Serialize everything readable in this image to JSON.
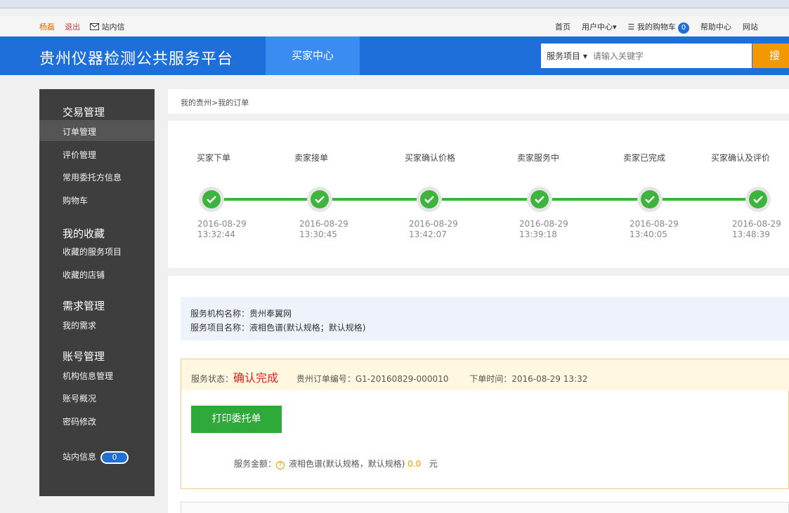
{
  "topbar": {
    "user": "杨磊",
    "logout": "退出",
    "mail": "站内信",
    "home": "首页",
    "user_center": "用户中心",
    "cart": "我的购物车",
    "cart_count": "0",
    "help": "帮助中心",
    "site": "网站"
  },
  "header": {
    "logo": "贵州仪器检测公共服务平台",
    "tab": "买家中心",
    "search_category": "服务项目",
    "search_placeholder": "请输入关键字",
    "search_button": "搜索"
  },
  "sidebar": {
    "groups": [
      "交易管理",
      "我的收藏",
      "需求管理",
      "账号管理"
    ],
    "items": [
      "订单管理",
      "评价管理",
      "常用委托方信息",
      "购物车",
      "收藏的服务项目",
      "收藏的店铺",
      "我的需求",
      "机构信息管理",
      "账号概况",
      "密码修改"
    ],
    "messages_label": "站内信息",
    "messages_count": "0"
  },
  "breadcrumb": "我的贵州>我的订单",
  "steps": [
    {
      "label": "买家下单",
      "date": "2016-08-29",
      "time": "13:32:44"
    },
    {
      "label": "卖家接单",
      "date": "2016-08-29",
      "time": "13:30:45"
    },
    {
      "label": "买家确认价格",
      "date": "2016-08-29",
      "time": "13:42:07"
    },
    {
      "label": "卖家服务中",
      "date": "2016-08-29",
      "time": "13:39:18"
    },
    {
      "label": "卖家已完成",
      "date": "2016-08-29",
      "time": "13:40:05"
    },
    {
      "label": "买家确认及评价",
      "date": "2016-08-29",
      "time": "13:48:39"
    }
  ],
  "service": {
    "org_label": "服务机构名称：",
    "org_name": "贵州奉翼网",
    "item_label": "服务项目名称：",
    "item_name": "液相色谱(默认规格；默认规格)"
  },
  "order": {
    "status_label": "服务状态：",
    "status": "确认完成",
    "order_no_label": "贵州订单编号：",
    "order_no": "G1-20160829-000010",
    "time_label": "下单时间：",
    "time": "2016-08-29 13:32",
    "print_button": "打印委托单",
    "amount_label": "服务金额：",
    "amount_item": "液相色谱(默认规格，默认规格)",
    "amount_value": "0.0",
    "currency": "元"
  },
  "colors": {
    "primary_blue": "#1e6fd9",
    "green": "#3db53d",
    "orange": "#f39800",
    "status_red": "#e02020"
  }
}
